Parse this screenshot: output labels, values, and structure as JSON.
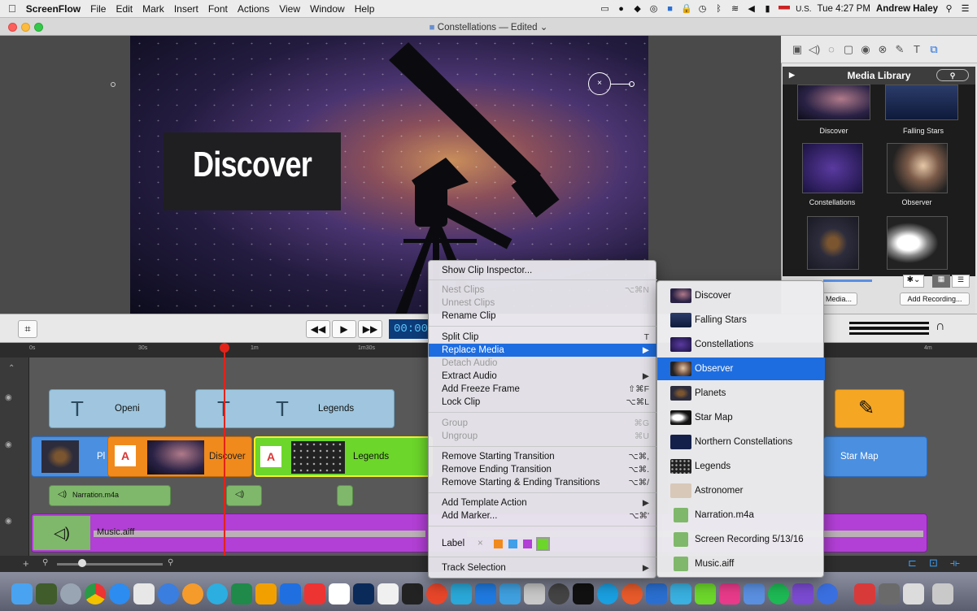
{
  "menubar": {
    "apple": "",
    "app_name": "ScreenFlow",
    "menus": [
      "File",
      "Edit",
      "Mark",
      "Insert",
      "Font",
      "Actions",
      "View",
      "Window",
      "Help"
    ],
    "input_source": "U.S.",
    "clock": "Tue 4:27 PM",
    "user": "Andrew Haley"
  },
  "window": {
    "title": "Constellations — Edited"
  },
  "canvas": {
    "title_overlay": "Discover"
  },
  "library": {
    "title": "Media Library",
    "thumbs": [
      "Discover",
      "Falling Stars",
      "Constellations",
      "Observer"
    ],
    "add_media": "Media...",
    "add_recording": "Add Recording..."
  },
  "transport": {
    "timecode": "00:00"
  },
  "timeline": {
    "ruler": [
      "0s",
      "30s",
      "1m",
      "1m30s",
      "4m"
    ],
    "clips": {
      "opening": "Openi",
      "legends_title": "Legends",
      "planets_short": "Pl",
      "discover": "Discover",
      "legends_video": "Legends",
      "star_map": "Star Map",
      "narration": "Narration.m4a",
      "music": "Music.aiff"
    }
  },
  "context_menu": {
    "show_inspector": "Show Clip Inspector...",
    "nest": "Nest Clips",
    "nest_sc": "⌥⌘N",
    "unnest": "Unnest Clips",
    "rename": "Rename Clip",
    "split": "Split Clip",
    "split_sc": "T",
    "replace": "Replace Media",
    "detach": "Detach Audio",
    "extract": "Extract Audio",
    "freeze": "Add Freeze Frame",
    "freeze_sc": "⇧⌘F",
    "lock": "Lock Clip",
    "lock_sc": "⌥⌘L",
    "group": "Group",
    "group_sc": "⌘G",
    "ungroup": "Ungroup",
    "ungroup_sc": "⌘U",
    "remove_start": "Remove Starting Transition",
    "remove_start_sc": "⌥⌘,",
    "remove_end": "Remove Ending Transition",
    "remove_end_sc": "⌥⌘.",
    "remove_both": "Remove Starting & Ending Transitions",
    "remove_both_sc": "⌥⌘/",
    "template": "Add Template Action",
    "marker": "Add Marker...",
    "marker_sc": "⌥⌘'",
    "label": "Label",
    "track_selection": "Track Selection"
  },
  "submenu": {
    "items": [
      "Discover",
      "Falling Stars",
      "Constellations",
      "Observer",
      "Planets",
      "Star Map",
      "Northern Constellations",
      "Legends",
      "Astronomer",
      "Narration.m4a",
      "Screen Recording 5/13/16",
      "Music.aiff"
    ],
    "selected": "Observer"
  },
  "colors": {
    "accent": "#1e6de0",
    "playhead": "#e2231a",
    "text_clip": "#8fbad6",
    "video_clip": "#4a8fe0",
    "audio_clip": "#b23fd6",
    "selected_clip": "#6cd62a"
  }
}
